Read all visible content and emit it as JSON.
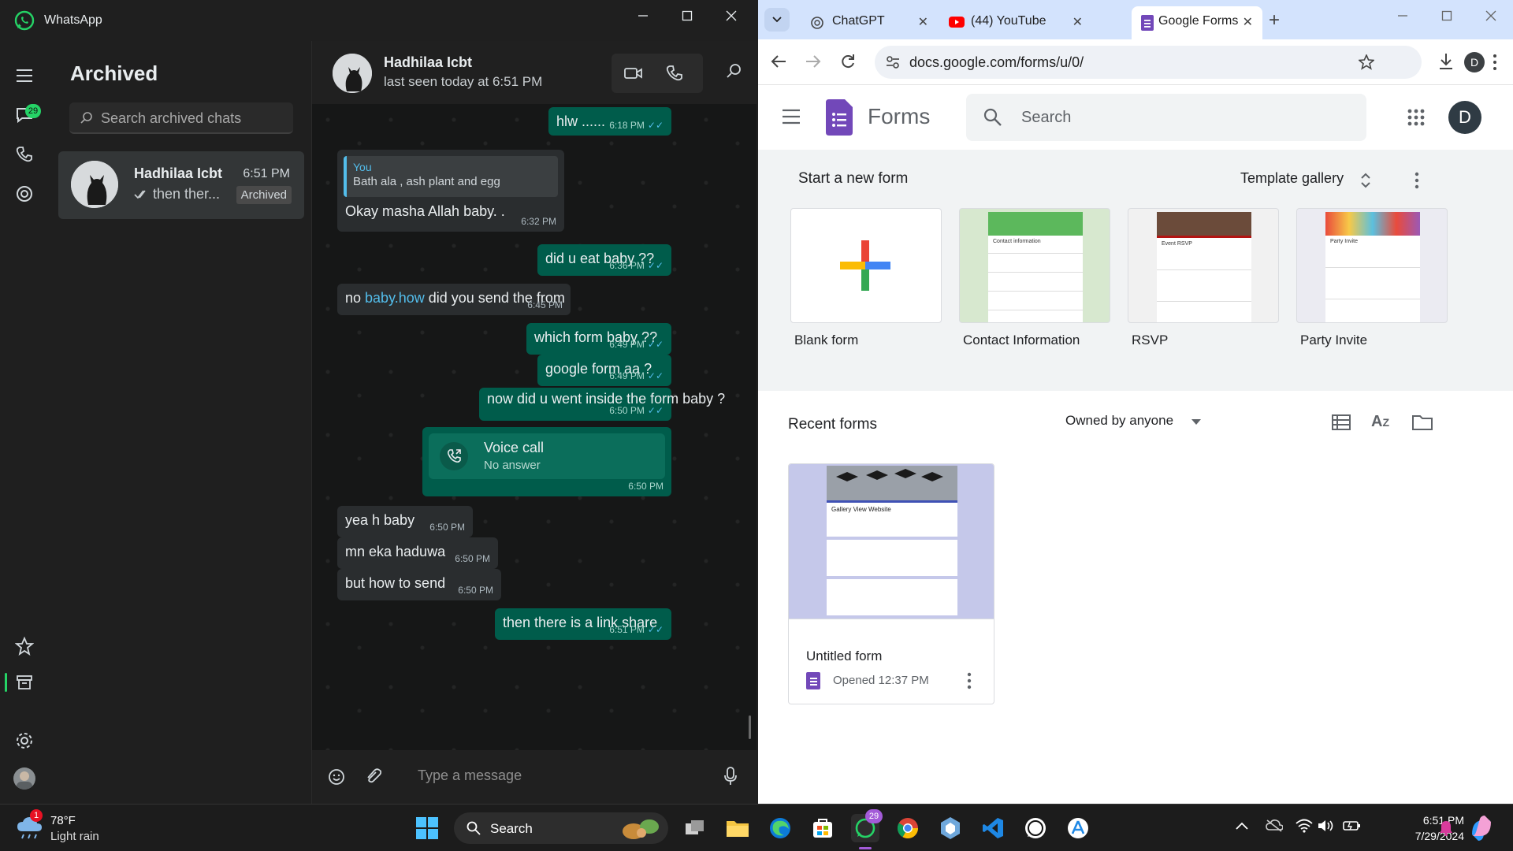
{
  "whatsapp": {
    "window_title": "WhatsApp",
    "rail": {
      "chats_badge": "29"
    },
    "list": {
      "heading": "Archived",
      "search_placeholder": "Search archived chats",
      "chat": {
        "name": "Hadhilaa Icbt",
        "time": "6:51 PM",
        "preview": "then ther...",
        "badge": "Archived"
      }
    },
    "conversation": {
      "contact_name": "Hadhilaa Icbt",
      "last_seen": "last seen today at 6:51 PM",
      "messages": [
        {
          "dir": "out",
          "text": "hlw ......",
          "time": "6:18 PM"
        },
        {
          "dir": "in",
          "reply_author": "You",
          "reply_text": "Bath ala , ash plant and egg",
          "text": "Okay masha Allah baby. .",
          "time": "6:32 PM"
        },
        {
          "dir": "out",
          "text": "did u eat baby ??",
          "time": "6:36 PM"
        },
        {
          "dir": "in",
          "text_before": "no ",
          "link": "baby.how",
          "text_after": " did you send the from",
          "time": "6:45 PM"
        },
        {
          "dir": "out",
          "text": "which form baby ??",
          "time": "6:49 PM"
        },
        {
          "dir": "out",
          "text": "google form aa ?",
          "time": "6:49 PM"
        },
        {
          "dir": "out",
          "text": "now did u went inside the form baby ?",
          "time": "6:50 PM"
        },
        {
          "dir": "out",
          "call_title": "Voice call",
          "call_status": "No answer",
          "time": "6:50 PM"
        },
        {
          "dir": "in",
          "text": "yea h baby",
          "time": "6:50 PM"
        },
        {
          "dir": "in",
          "text": "mn eka haduwa",
          "time": "6:50 PM"
        },
        {
          "dir": "in",
          "text": "but how to send",
          "time": "6:50 PM"
        },
        {
          "dir": "out",
          "text": "then there is a link share",
          "time": "6:51 PM"
        }
      ],
      "input_placeholder": "Type a message"
    }
  },
  "chrome": {
    "tabs": [
      {
        "label": "ChatGPT",
        "icon": "chatgpt-icon"
      },
      {
        "label": "(44) YouTube",
        "icon": "youtube-icon"
      },
      {
        "label": "Google Forms",
        "icon": "forms-icon",
        "active": true
      }
    ],
    "url": "docs.google.com/forms/u/0/",
    "profile_initial": "D",
    "forms": {
      "app_name": "Forms",
      "search_placeholder": "Search",
      "account_initial": "D",
      "start_heading": "Start a new form",
      "template_gallery": "Template gallery",
      "templates": [
        {
          "label": "Blank form"
        },
        {
          "label": "Contact Information",
          "thumb_title": "Contact information"
        },
        {
          "label": "RSVP",
          "thumb_title": "Event RSVP"
        },
        {
          "label": "Party Invite",
          "thumb_title": "Party Invite"
        }
      ],
      "recent_heading": "Recent forms",
      "owner_filter": "Owned by anyone",
      "recent": [
        {
          "name": "Untitled form",
          "opened": "Opened 12:37 PM",
          "thumb_title": "Gallery View Website"
        }
      ]
    }
  },
  "taskbar": {
    "weather": {
      "temp": "78°F",
      "condition": "Light rain",
      "badge": "1"
    },
    "search_placeholder": "Search",
    "whatsapp_badge": "29",
    "time": "6:51 PM",
    "date": "7/29/2024"
  },
  "colors": {
    "whatsapp_green": "#25d366",
    "outgoing_bubble": "#005c4b",
    "incoming_bubble": "#2a2d2f",
    "forms_purple": "#673ab7",
    "chrome_tabbar": "#d3e3fd"
  }
}
